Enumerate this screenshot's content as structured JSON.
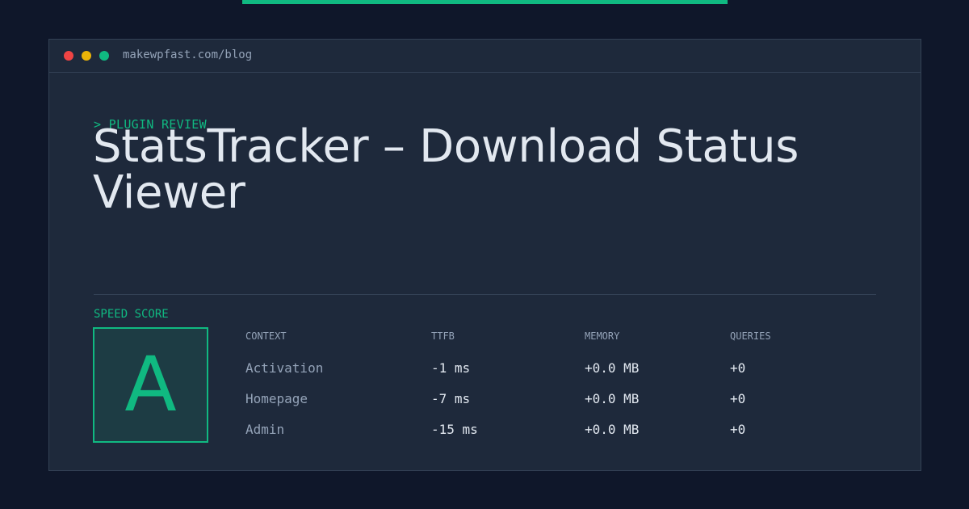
{
  "colors": {
    "background": "#0f172a",
    "card": "#1e293b",
    "border": "#334155",
    "accent": "#10b981",
    "text": "#e2e8f0",
    "muted": "#94a3b8",
    "score_fill": "#1d3c44",
    "dot_red": "#ef4444",
    "dot_yellow": "#eab308",
    "dot_green": "#10b981"
  },
  "window": {
    "url": "makewpfast.com/blog"
  },
  "article": {
    "kicker": "> PLUGIN REVIEW",
    "title": "StatsTracker – Download Status Viewer"
  },
  "score": {
    "label": "SPEED SCORE",
    "grade": "A"
  },
  "table": {
    "columns": [
      "CONTEXT",
      "TTFB",
      "MEMORY",
      "QUERIES"
    ],
    "rows": [
      {
        "context": "Activation",
        "ttfb": "-1 ms",
        "memory": "+0.0 MB",
        "queries": "+0"
      },
      {
        "context": "Homepage",
        "ttfb": "-7 ms",
        "memory": "+0.0 MB",
        "queries": "+0"
      },
      {
        "context": "Admin",
        "ttfb": "-15 ms",
        "memory": "+0.0 MB",
        "queries": "+0"
      }
    ]
  }
}
